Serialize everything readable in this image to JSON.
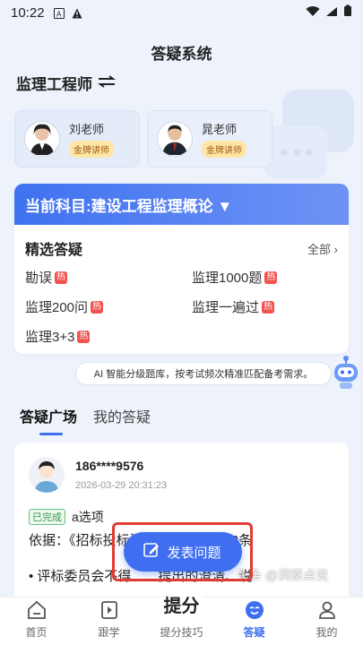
{
  "status": {
    "time": "10:22"
  },
  "header": {
    "title": "答疑系统",
    "major": "监理工程师"
  },
  "teachers": [
    {
      "name": "刘老师",
      "badge": "金牌讲师"
    },
    {
      "name": "晁老师",
      "badge": "金牌讲师"
    }
  ],
  "subject": {
    "label": "当前科目:建设工程监理概论 ▼"
  },
  "featured": {
    "title": "精选答疑",
    "more": "全部",
    "hot_label": "热",
    "items": [
      "勘误",
      "监理1000题",
      "监理200问",
      "监理一遍过",
      "监理3+3"
    ]
  },
  "ai_tip": "AI 智能分级题库，按考试频次精准匹配备考需求。",
  "tabs": [
    "答疑广场",
    "我的答疑"
  ],
  "post": {
    "user": "186****9576",
    "time": "2026-03-29 20:31:23",
    "status": "已完成",
    "answer": "a选项",
    "basis": "依据：《招标投标法实施条例》第52条",
    "bullet": "• 评标委员会不得……提出的澄清、说"
  },
  "watermark": "头条 @洞察点说",
  "fab": {
    "label": "发表问题"
  },
  "nav": {
    "home": "首页",
    "study": "跟学",
    "center_logo": "提分",
    "tips": "提分技巧",
    "qa": "答疑",
    "mine": "我的"
  },
  "colors": {
    "accent": "#3e6ef0",
    "highlight_border": "#e23b33",
    "hot": "#f0534f"
  }
}
